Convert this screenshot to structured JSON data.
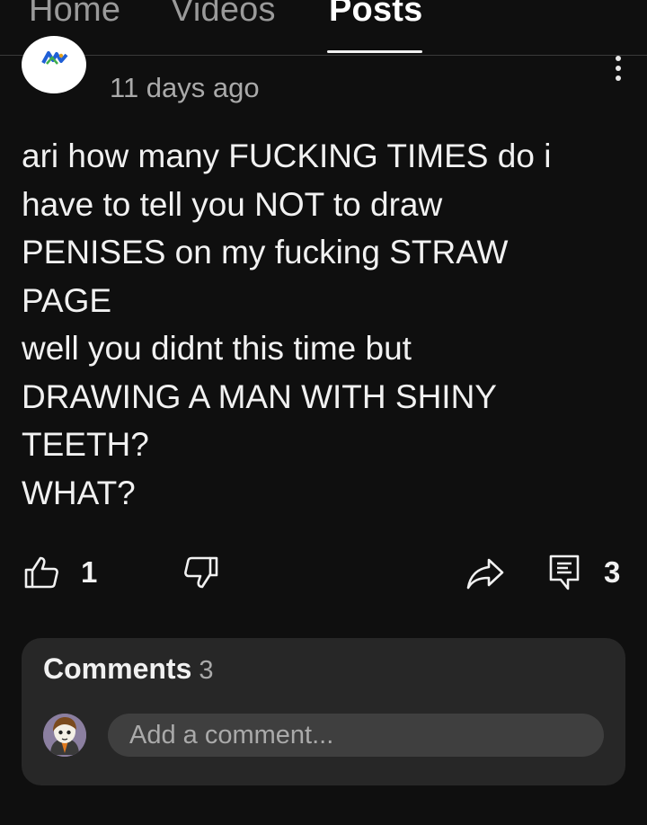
{
  "tabs": [
    {
      "label": "Home",
      "active": false
    },
    {
      "label": "Videos",
      "active": false
    },
    {
      "label": "Posts",
      "active": true
    }
  ],
  "post": {
    "timestamp": "11 days ago",
    "lines": [
      "ari how many FUCKING TIMES do i",
      "have to tell you NOT to draw",
      "PENISES on my fucking STRAW",
      "PAGE",
      "well you didnt this time but",
      "DRAWING A MAN WITH SHINY",
      "TEETH?",
      "WHAT?"
    ],
    "likes": "1",
    "comment_count": "3"
  },
  "comments": {
    "title": "Comments",
    "count": "3",
    "placeholder": "Add a comment..."
  },
  "icons": {
    "like": "thumbs-up-icon",
    "dislike": "thumbs-down-icon",
    "share": "share-icon",
    "comment": "comment-icon",
    "menu": "more-vertical-icon"
  },
  "colors": {
    "background": "#0f0f0f",
    "card": "#272727",
    "input": "#3f3f3f",
    "text": "#f1f1f1",
    "muted": "#aaaaaa"
  }
}
